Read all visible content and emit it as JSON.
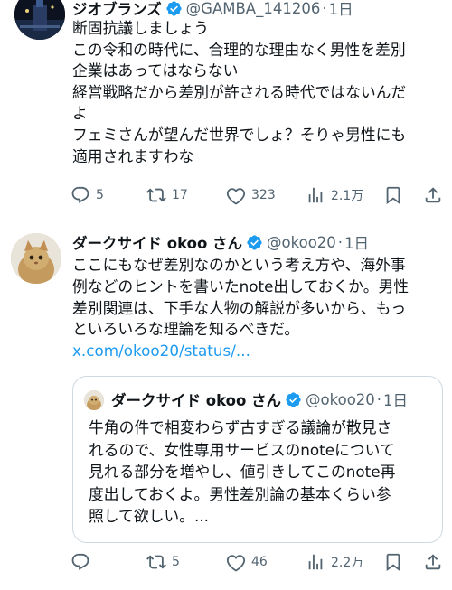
{
  "tweet1": {
    "name": "ジオブランズ",
    "handle": "@GAMBA_141206",
    "dot": "·",
    "time": "1日",
    "lines": [
      "断固抗議しましょう",
      "この令和の時代に、合理的な理由なく男性を差別",
      "企業はあってはならない",
      "経営戦略だから差別が許される時代ではないんだ",
      "よ",
      "フェミさんが望んだ世界でしょ？そりゃ男性にも",
      "適用されますわな"
    ],
    "actions": {
      "replies": "5",
      "retweets": "17",
      "likes": "323",
      "views": "2.1万"
    }
  },
  "tweet2": {
    "name": "ダークサイド okoo さん",
    "handle": "@okoo20",
    "dot": "·",
    "time": "1日",
    "lines": [
      "ここにもなぜ差別なのかという考え方や、海外事",
      "例などのヒントを書いたnote出しておくか。男性",
      "差別関連は、下手な人物の解説が多いから、もっ",
      "といろいろな理論を知るべきだ。"
    ],
    "link": "x.com/okoo20/status/...",
    "quote": {
      "name": "ダークサイド okoo さん",
      "handle": "@okoo20",
      "dot": "·",
      "time": "1日",
      "lines": [
        "牛角の件で相変わらず古すぎる議論が散見さ",
        "れるので、女性専用サービスのnoteについて",
        "見れる部分を増やし、値引きしてこのnote再",
        "度出しておくよ。男性差別論の基本くらい参",
        "照して欲しい。..."
      ]
    },
    "actions": {
      "replies": "",
      "retweets": "5",
      "likes": "46",
      "views": "2.2万"
    }
  },
  "colors": {
    "text": "#0f1419",
    "secondary": "#536471",
    "link": "#1d9bf0",
    "verified": "#1d9bf0",
    "border": "#cfd9de"
  },
  "icons": [
    "verified-badge-icon",
    "reply-icon",
    "retweet-icon",
    "like-icon",
    "views-icon",
    "bookmark-icon",
    "share-icon"
  ]
}
